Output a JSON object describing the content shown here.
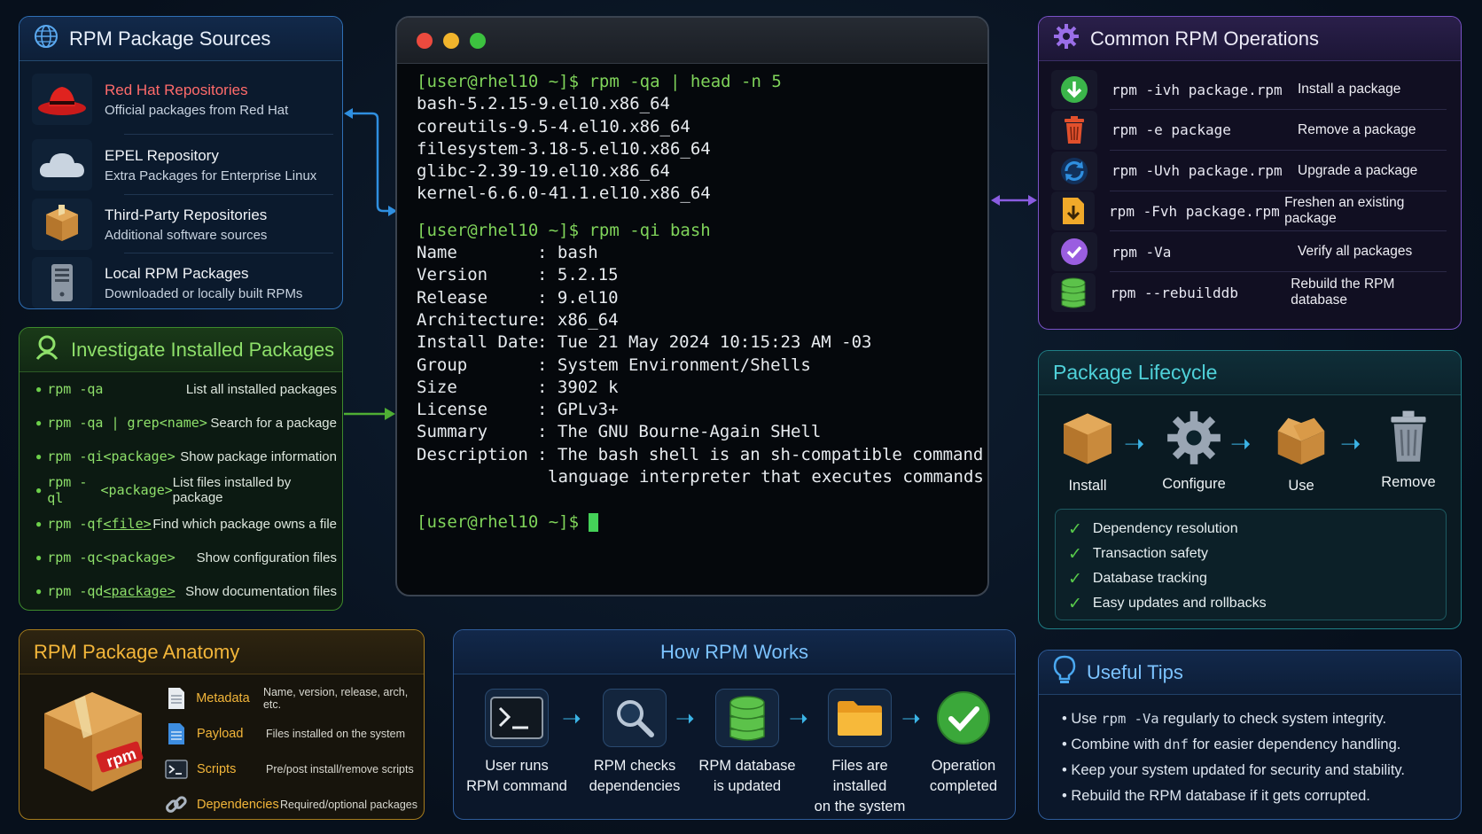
{
  "sources": {
    "title": "RPM Package Sources",
    "items": [
      {
        "title": "Red Hat Repositories",
        "desc": "Official packages from Red Hat",
        "icon": "red-hat-icon"
      },
      {
        "title": "EPEL Repository",
        "desc": "Extra Packages for Enterprise Linux",
        "icon": "cloud-icon"
      },
      {
        "title": "Third-Party Repositories",
        "desc": "Additional software sources",
        "icon": "package-box-icon"
      },
      {
        "title": "Local RPM Packages",
        "desc": "Downloaded or locally built RPMs",
        "icon": "server-icon"
      }
    ]
  },
  "investigate": {
    "title": "Investigate Installed Packages",
    "items": [
      {
        "cmd": "rpm -qa",
        "arg": "",
        "desc": "List all installed packages"
      },
      {
        "cmd": "rpm -qa | grep",
        "arg": " <name>",
        "desc": "Search for a package"
      },
      {
        "cmd": "rpm -qi",
        "arg": " <package>",
        "desc": "Show package information"
      },
      {
        "cmd": "rpm -ql",
        "arg": " <package>",
        "desc": "List files installed by package"
      },
      {
        "cmd": "rpm -qf ",
        "arg": "<file>",
        "desc": "Find which package owns a file"
      },
      {
        "cmd": "rpm -qc",
        "arg": " <package>",
        "desc": "Show configuration files"
      },
      {
        "cmd": "rpm -qd ",
        "arg": "<package>",
        "desc": "Show documentation files"
      }
    ]
  },
  "terminal": {
    "prompt": "[user@rhel10 ~]$",
    "cmd1": " rpm -qa | head -n 5",
    "out1": [
      "bash-5.2.15-9.el10.x86_64",
      "coreutils-9.5-4.el10.x86_64",
      "filesystem-3.18-5.el10.x86_64",
      "glibc-2.39-19.el10.x86_64",
      "kernel-6.6.0-41.1.el10.x86_64"
    ],
    "cmd2": " rpm -qi bash",
    "info": [
      {
        "k": "Name",
        "v": "bash"
      },
      {
        "k": "Version",
        "v": "5.2.15"
      },
      {
        "k": "Release",
        "v": "9.el10"
      },
      {
        "k": "Architecture",
        "v": "x86_64"
      },
      {
        "k": "Install Date",
        "v": "Tue 21 May 2024 10:15:23 AM -03"
      },
      {
        "k": "Group",
        "v": "System Environment/Shells"
      },
      {
        "k": "Size",
        "v": "3902 k"
      },
      {
        "k": "License",
        "v": "GPLv3+"
      },
      {
        "k": "Summary",
        "v": "The GNU Bourne-Again SHell"
      },
      {
        "k": "Description",
        "v": "The bash shell is an sh-compatible command"
      }
    ],
    "desc_cont": "language interpreter that executes commands"
  },
  "operations": {
    "title": "Common RPM Operations",
    "items": [
      {
        "cmd": "rpm -ivh package.rpm",
        "desc": "Install a package",
        "icon": "download-icon",
        "color": "#3bb54a"
      },
      {
        "cmd": "rpm -e package",
        "desc": "Remove a package",
        "icon": "trash-icon",
        "color": "#e2502c"
      },
      {
        "cmd": "rpm -Uvh package.rpm",
        "desc": "Upgrade a package",
        "icon": "refresh-icon",
        "color": "#2f8fe0"
      },
      {
        "cmd": "rpm -Fvh package.rpm",
        "desc": "Freshen an existing package",
        "icon": "file-download-icon",
        "color": "#f0a92a"
      },
      {
        "cmd": "rpm -Va",
        "desc": "Verify all packages",
        "icon": "verify-icon",
        "color": "#9a5ee0"
      },
      {
        "cmd": "rpm --rebuilddb",
        "desc": "Rebuild the RPM database",
        "icon": "database-icon",
        "color": "#5cc24a"
      }
    ]
  },
  "lifecycle": {
    "title": "Package Lifecycle",
    "steps": [
      "Install",
      "Configure",
      "Use",
      "Remove"
    ],
    "benefits": [
      "Dependency resolution",
      "Transaction safety",
      "Database tracking",
      "Easy updates and rollbacks"
    ]
  },
  "tips": {
    "title": "Useful Tips",
    "items": [
      {
        "pre": "Use ",
        "code": "rpm -Va",
        "post": " regularly to check system integrity."
      },
      {
        "pre": "Combine with ",
        "code": "dnf",
        "post": " for easier dependency handling."
      },
      {
        "pre": "Keep your system updated for security and stability.",
        "code": "",
        "post": ""
      },
      {
        "pre": "Rebuild the RPM database if it gets corrupted.",
        "code": "",
        "post": ""
      }
    ]
  },
  "anatomy": {
    "title": "RPM Package Anatomy",
    "box_label": "rpm",
    "items": [
      {
        "name": "Metadata",
        "desc": "Name, version, release, arch, etc."
      },
      {
        "name": "Payload",
        "desc": "Files installed on the system"
      },
      {
        "name": "Scripts",
        "desc": "Pre/post install/remove scripts"
      },
      {
        "name": "Dependencies",
        "desc": "Required/optional packages"
      }
    ]
  },
  "how": {
    "title": "How RPM Works",
    "steps": [
      {
        "l1": "User runs",
        "l2": "RPM command"
      },
      {
        "l1": "RPM checks",
        "l2": "dependencies"
      },
      {
        "l1": "RPM database",
        "l2": "is updated"
      },
      {
        "l1": "Files are installed",
        "l2": "on the system"
      },
      {
        "l1": "Operation",
        "l2": "completed"
      }
    ]
  }
}
